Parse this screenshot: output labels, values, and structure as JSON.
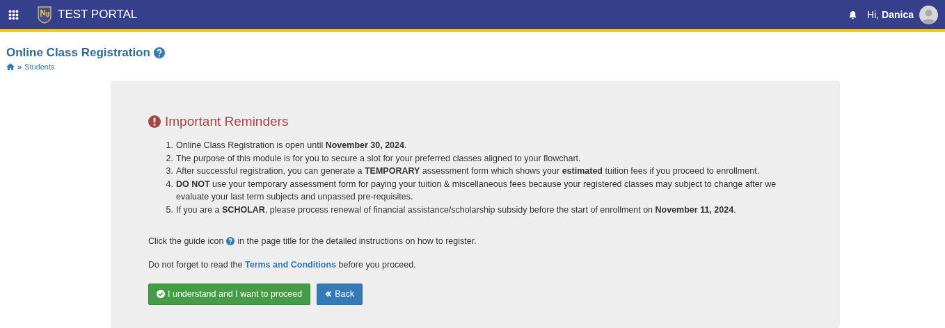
{
  "header": {
    "brand": "TEST PORTAL",
    "greeting": "Hi, ",
    "user": "Danica"
  },
  "page": {
    "title": "Online Class Registration",
    "breadcrumb": [
      {
        "kind": "home"
      },
      {
        "kind": "link",
        "label": "Students"
      }
    ],
    "separator": "»"
  },
  "card": {
    "heading": "Important Reminders",
    "reminders": [
      {
        "number": "1.",
        "text": "Online Class Registration is open until **November 30, 2024**."
      },
      {
        "number": "2.",
        "text": "The purpose of this module is for you to secure a slot for your preferred classes aligned to your flowchart."
      },
      {
        "number": "3.",
        "text": "After successful registration, you can generate a **TEMPORARY** assessment form which shows your **estimated** tuition fees if you proceed to enrollment."
      },
      {
        "number": "4.",
        "text": "**DO NOT** use your temporary assessment form for paying your tuition & miscellaneous fees because your registered classes may subject to change after we evaluate your last term subjects and unpassed pre-requisites."
      },
      {
        "number": "5.",
        "text": "If you are a **SCHOLAR**, please process renewal of financial assistance/scholarship subsidy before the start of enrollment on **November 11, 2024**."
      }
    ],
    "guide_before": "Click the guide icon",
    "guide_after": "in the page title for the detailed instructions on how to register.",
    "terms_before": "Do not forget to read the",
    "terms_link": "Terms and Conditions",
    "terms_after": "before you proceed.",
    "buttons": [
      {
        "kind": "proceed",
        "label": "I understand and I want to proceed"
      },
      {
        "kind": "back",
        "label": "Back"
      }
    ]
  }
}
